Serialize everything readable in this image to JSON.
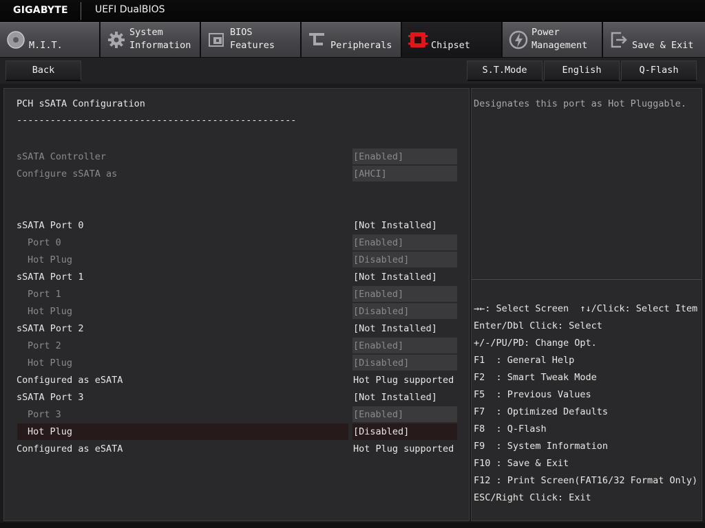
{
  "header": {
    "brand": "GIGABYTE",
    "product": "UEFI DualBIOS"
  },
  "tabs": [
    {
      "label": "M.I.T.",
      "icon": "disc-icon"
    },
    {
      "label": "System\nInformation",
      "icon": "gear-icon"
    },
    {
      "label": "BIOS\nFeatures",
      "icon": "chip-board-icon"
    },
    {
      "label": "Peripherals",
      "icon": "connector-icon"
    },
    {
      "label": "Chipset",
      "icon": "chipset-icon",
      "active": true
    },
    {
      "label": "Power\nManagement",
      "icon": "power-icon"
    },
    {
      "label": "Save & Exit",
      "icon": "exit-icon"
    }
  ],
  "toolbar": {
    "back": "Back",
    "stmode": "S.T.Mode",
    "language": "English",
    "qflash": "Q-Flash"
  },
  "main": {
    "title": "PCH sSATA Configuration",
    "divider": "--------------------------------------------------",
    "rows": [
      {
        "label": "sSATA Controller",
        "value": "[Enabled]"
      },
      {
        "label": "Configure sSATA as",
        "value": "[AHCI]"
      },
      {
        "label": "sSATA Port 0",
        "value": "[Not Installed]"
      },
      {
        "label": "Port 0",
        "value": "[Enabled]"
      },
      {
        "label": "Hot Plug",
        "value": "[Disabled]"
      },
      {
        "label": "sSATA Port 1",
        "value": "[Not Installed]"
      },
      {
        "label": "Port 1",
        "value": "[Enabled]"
      },
      {
        "label": "Hot Plug",
        "value": "[Disabled]"
      },
      {
        "label": "sSATA Port 2",
        "value": "[Not Installed]"
      },
      {
        "label": "Port 2",
        "value": "[Enabled]"
      },
      {
        "label": "Hot Plug",
        "value": "[Disabled]"
      },
      {
        "label": "Configured as eSATA",
        "value": "Hot Plug supported"
      },
      {
        "label": "sSATA Port 3",
        "value": "[Not Installed]"
      },
      {
        "label": "Port 3",
        "value": "[Enabled]"
      },
      {
        "label": "Hot Plug",
        "value": "[Disabled]"
      },
      {
        "label": "Configured as eSATA",
        "value": "Hot Plug supported"
      }
    ]
  },
  "side": {
    "description": "Designates this port as Hot Pluggable.",
    "help": [
      "→←: Select Screen  ↑↓/Click: Select Item",
      "Enter/Dbl Click: Select",
      "+/-/PU/PD: Change Opt.",
      "F1  : General Help",
      "F2  : Smart Tweak Mode",
      "F5  : Previous Values",
      "F7  : Optimized Defaults",
      "F8  : Q-Flash",
      "F9  : System Information",
      "F10 : Save & Exit",
      "F12 : Print Screen(FAT16/32 Format Only)",
      "ESC/Right Click: Exit"
    ]
  }
}
